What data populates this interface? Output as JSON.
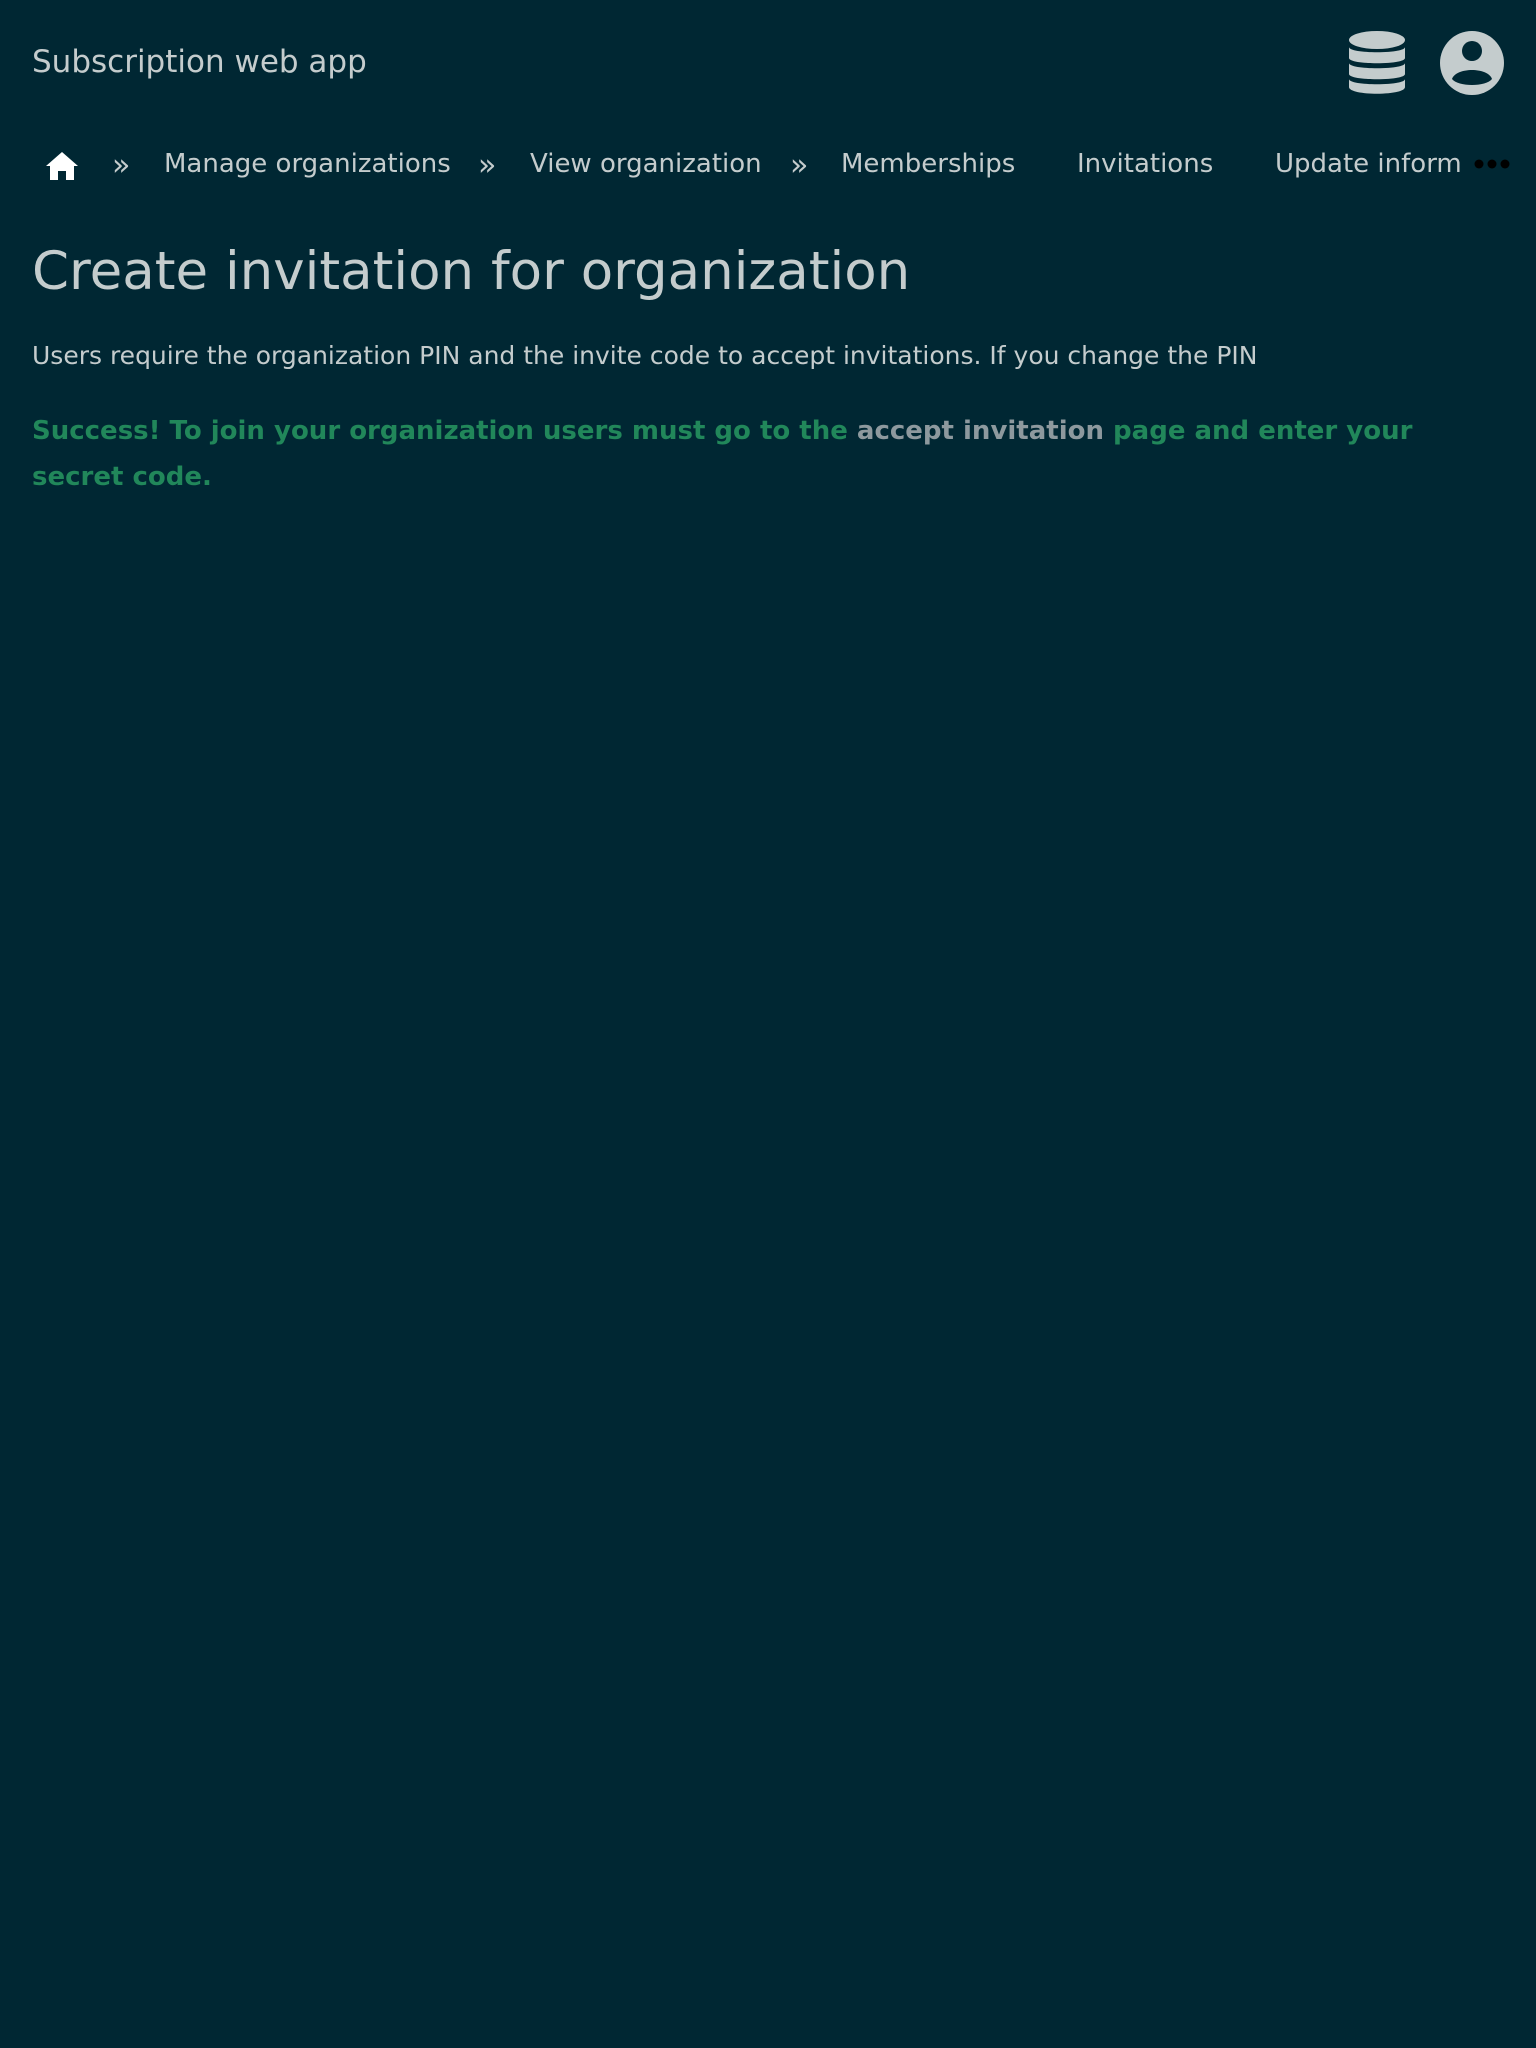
{
  "header": {
    "app_title": "Subscription web app",
    "icons": [
      "database-icon",
      "user-account-icon"
    ]
  },
  "nav": {
    "home_icon": "home-icon",
    "separator": "»",
    "items": [
      {
        "label": "Manage organizations"
      },
      {
        "label": "View organization"
      },
      {
        "label": "Memberships"
      },
      {
        "label": "Invitations"
      },
      {
        "label": "Update inform"
      }
    ],
    "more_icon": "ellipsis-icon"
  },
  "main": {
    "title": "Create invitation for organization",
    "description": "Users require the organization PIN and the invite code to accept invitations. If you change the PIN",
    "success": {
      "before": "Success! To join your organization users must go to the ",
      "link": "accept invitation",
      "after": " page and enter your secret code."
    }
  },
  "colors": {
    "background": "#002733",
    "text": "#c4cccd",
    "success": "#21875a",
    "link": "#8d999e"
  }
}
